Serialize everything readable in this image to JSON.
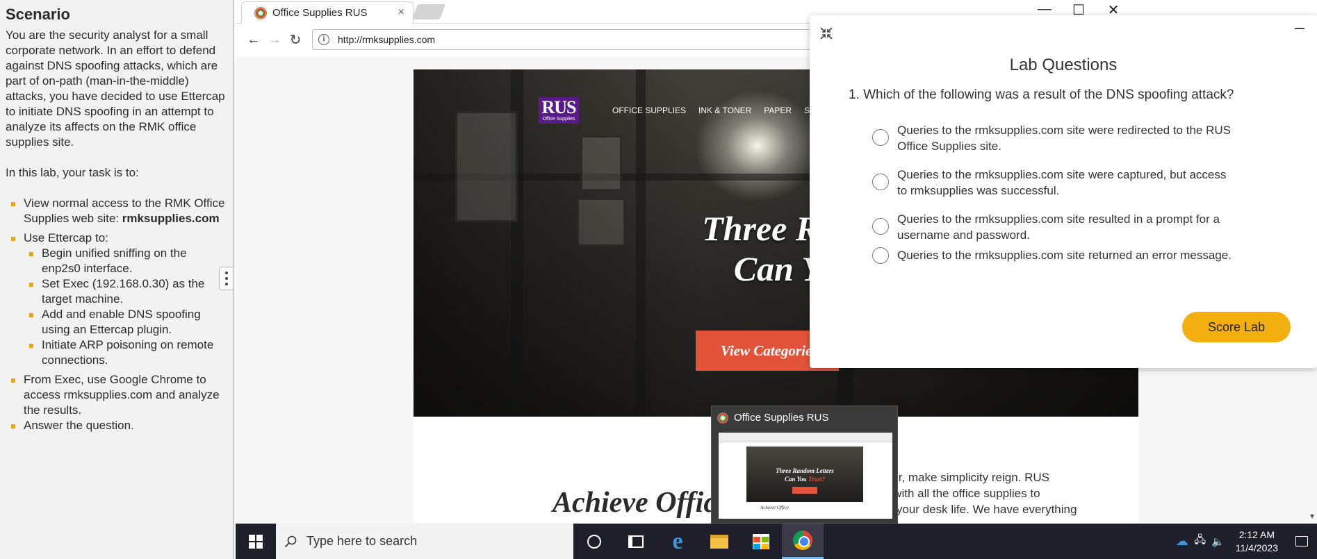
{
  "scenario": {
    "title": "Scenario",
    "intro": "You are the security analyst for a small corporate network. In an effort to defend against DNS spoofing attacks, which are part of on-path (man-in-the-middle) attacks, you have decided to use Ettercap to initiate DNS spoofing in an attempt to analyze its affects on the RMK office supplies site.",
    "task_intro": "In this lab, your task is to:",
    "task1_prefix": "View normal access to the RMK Office Supplies web site: ",
    "task1_site": "rmksupplies.com",
    "task2": "Use Ettercap to:",
    "subtasks": [
      "Begin unified sniffing on the enp2s0 interface.",
      "Set Exec (192.168.0.30) as the target machine.",
      "Add and enable DNS spoofing using an Ettercap plugin.",
      "Initiate ARP poisoning on remote connections."
    ],
    "task3": "From Exec, use Google Chrome to access rmksupplies.com and analyze the results.",
    "task4": "Answer the question."
  },
  "browser": {
    "tab_title": "Office Supplies RUS",
    "url": "http://rmksupplies.com",
    "window_controls": {
      "minimize": "—",
      "maximize": "☐",
      "close": "✕"
    }
  },
  "site": {
    "logo_main": "RUS",
    "logo_sub": "Office Supplies",
    "nav": [
      "OFFICE SUPPLIES",
      "INK & TONER",
      "PAPER",
      "ST"
    ],
    "headline_line1": "Three Random",
    "headline_line2_prefix": "Can You ",
    "headline_line2_accent": "T",
    "cta": "View Categorie",
    "achieve": "Achieve Office",
    "para_lines": [
      "wer, make simplicity reign. RUS",
      "u with all the office supplies to",
      "to your desk life. We have everything"
    ]
  },
  "preview": {
    "title": "Office Supplies RUS",
    "thumb_line1": "Three Random Letters",
    "thumb_line2_prefix": "Can You ",
    "thumb_line2_accent": "Trust?",
    "thumb_achieve": "Achieve Office"
  },
  "lab": {
    "title": "Lab Questions",
    "question": "1. Which of the following was a result of the DNS spoofing attack?",
    "options": [
      "Queries to the rmksupplies.com site were redirected to the RUS Office Supplies site.",
      "Queries to the rmksupplies.com site were captured, but access to rmksupplies was successful.",
      "Queries to the rmksupplies.com site resulted in a prompt for a username and password.",
      "Queries to the rmksupplies.com site returned an error message."
    ],
    "score_button": "Score Lab"
  },
  "taskbar": {
    "search_placeholder": "Type here to search",
    "time": "2:12 AM",
    "date": "11/4/2023",
    "apps": [
      "cortana-icon",
      "task-view-icon",
      "edge-icon",
      "file-explorer-icon",
      "store-icon",
      "chrome-icon"
    ]
  },
  "colors": {
    "accent_orange": "#f3ae0f",
    "bullet": "#f0a30a",
    "site_red": "#e2533a",
    "taskbar": "#1f1f2b"
  }
}
